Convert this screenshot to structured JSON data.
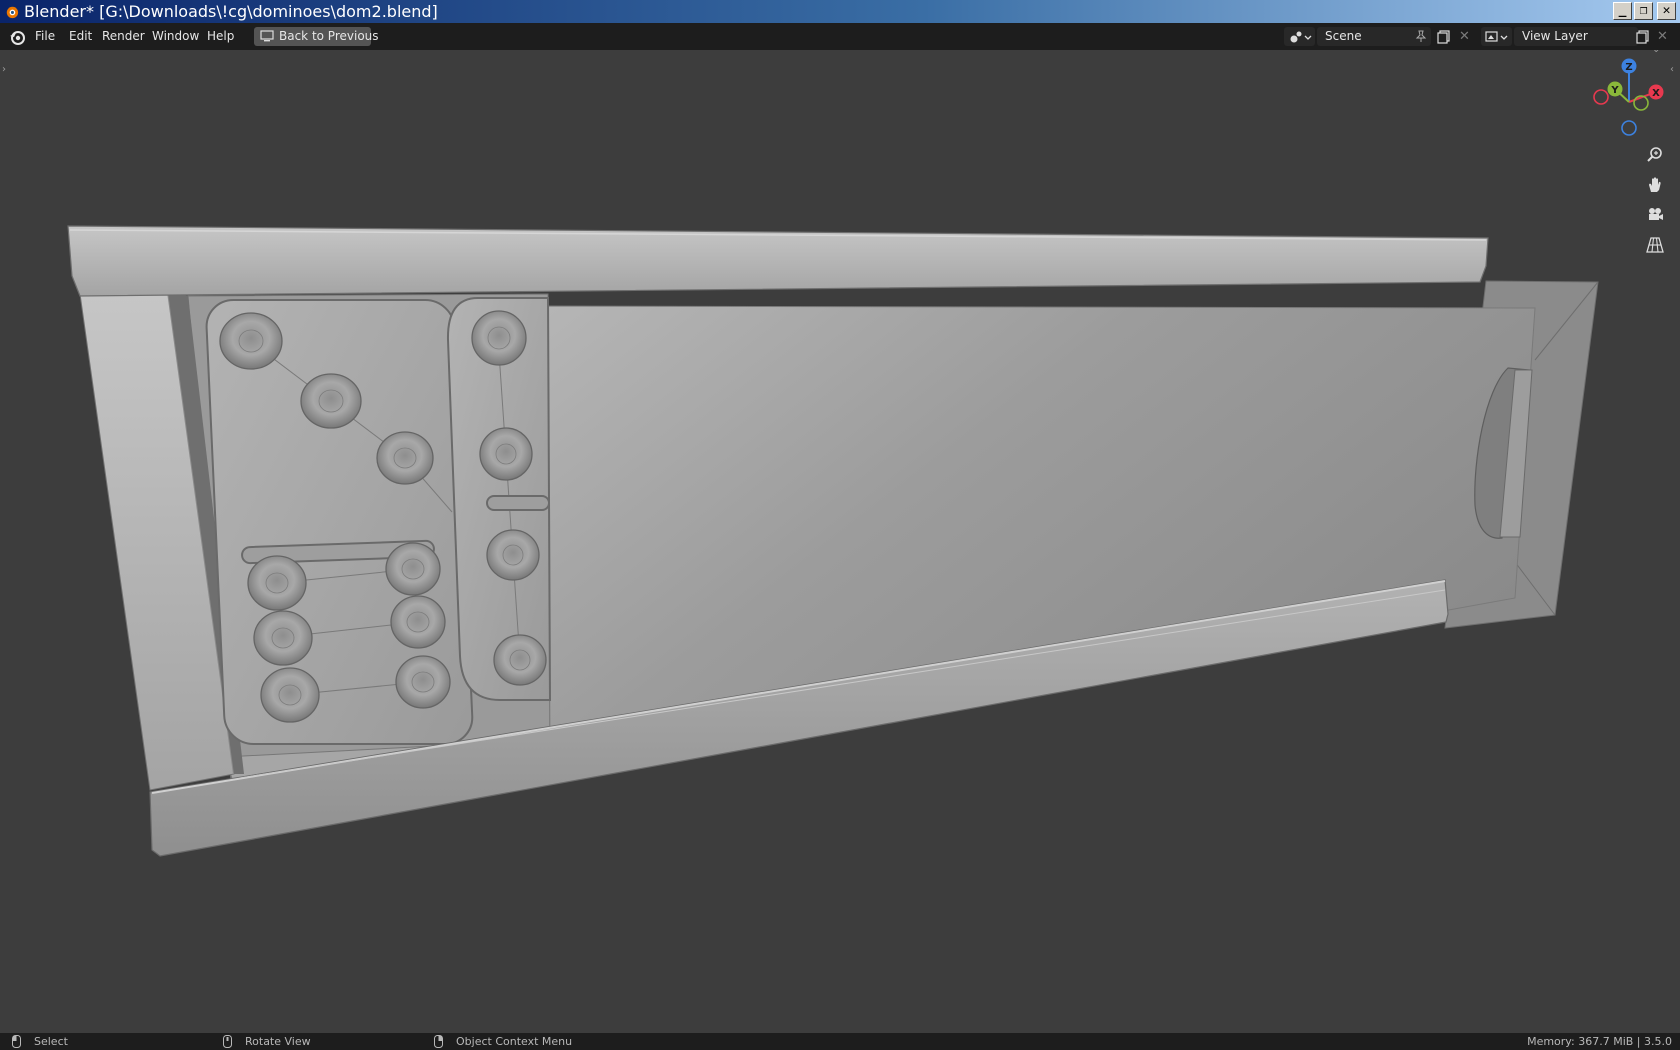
{
  "window": {
    "title": "Blender* [G:\\Downloads\\!cg\\dominoes\\dom2.blend]",
    "controls": {
      "minimize": "_",
      "restore": "❐",
      "close": "✕"
    }
  },
  "menu": {
    "file": "File",
    "edit": "Edit",
    "render": "Render",
    "window": "Window",
    "help": "Help"
  },
  "toolbar": {
    "back_label": "Back to Previous"
  },
  "scene_selector": {
    "value": "Scene"
  },
  "view_layer_selector": {
    "value": "View Layer"
  },
  "gizmo": {
    "z": "Z",
    "y": "Y",
    "x": "X"
  },
  "colors": {
    "axis_x": "#e8394f",
    "axis_y": "#8ab83a",
    "axis_z": "#3d82e0",
    "topbar": "#1d1d1d",
    "viewport": "#3d3d3d"
  },
  "nav_icons": [
    "zoom-icon",
    "pan-hand-icon",
    "camera-icon",
    "perspective-grid-icon"
  ],
  "status": {
    "select": "Select",
    "rotate": "Rotate View",
    "context": "Object Context Menu",
    "memory": "Memory: 367.7 MiB | 3.5.0"
  }
}
